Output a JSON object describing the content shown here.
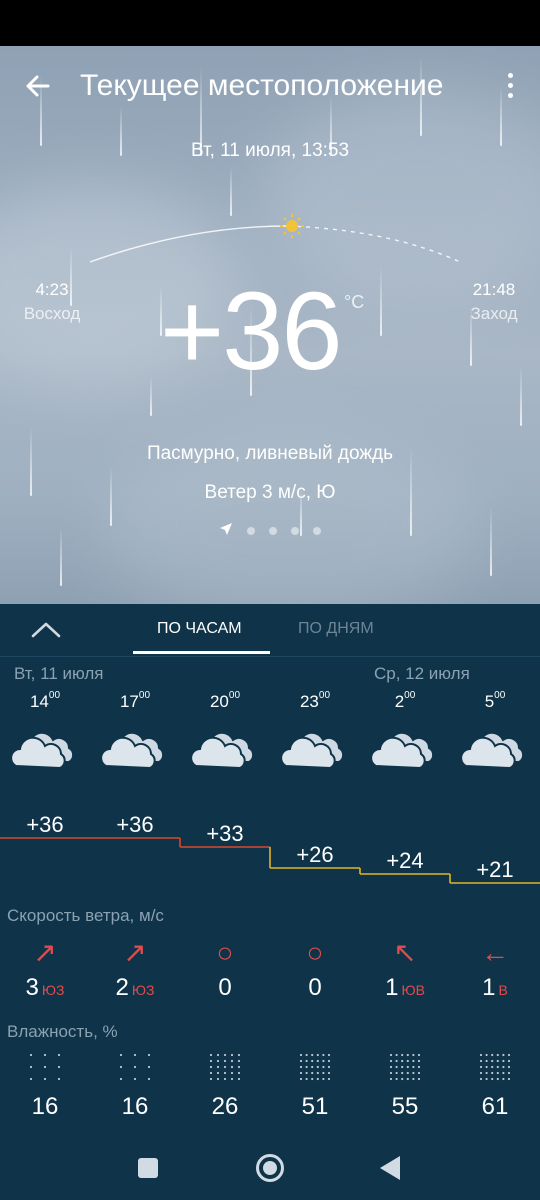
{
  "header": {
    "title": "Текущее местоположение",
    "datetime": "Вт, 11 июля, 13:53"
  },
  "sun": {
    "sunrise_time": "4:23",
    "sunrise_label": "Восход",
    "sunset_time": "21:48",
    "sunset_label": "Заход"
  },
  "current": {
    "temperature": "+36",
    "unit": "°C",
    "condition": "Пасмурно, ливневый дождь",
    "wind": "Ветер 3 м/с, Ю"
  },
  "tabs": {
    "hourly": "ПО ЧАСАМ",
    "daily": "ПО ДНЯМ"
  },
  "days": {
    "day1": "Вт, 11 июля",
    "day2": "Ср, 12 июля"
  },
  "hours": [
    {
      "h": "14",
      "m": "00",
      "temp": "+36",
      "temp_value": 36,
      "wind": "3",
      "wind_dir": "ЮЗ",
      "wind_arrow": "↗",
      "humidity": "16",
      "icon": "cloud-icon"
    },
    {
      "h": "17",
      "m": "00",
      "temp": "+36",
      "temp_value": 36,
      "wind": "2",
      "wind_dir": "ЮЗ",
      "wind_arrow": "↗",
      "humidity": "16",
      "icon": "cloud-icon"
    },
    {
      "h": "20",
      "m": "00",
      "temp": "+33",
      "temp_value": 33,
      "wind": "0",
      "wind_dir": "",
      "wind_arrow": "○",
      "humidity": "26",
      "icon": "cloud-icon"
    },
    {
      "h": "23",
      "m": "00",
      "temp": "+26",
      "temp_value": 26,
      "wind": "0",
      "wind_dir": "",
      "wind_arrow": "○",
      "humidity": "51",
      "icon": "cloud-icon"
    },
    {
      "h": "2",
      "m": "00",
      "temp": "+24",
      "temp_value": 24,
      "wind": "1",
      "wind_dir": "ЮВ",
      "wind_arrow": "↖",
      "humidity": "55",
      "icon": "cloud-icon"
    },
    {
      "h": "5",
      "m": "00",
      "temp": "+21",
      "temp_value": 21,
      "wind": "1",
      "wind_dir": "В",
      "wind_arrow": "←",
      "humidity": "61",
      "icon": "cloud-icon"
    }
  ],
  "sections": {
    "wind_title": "Скорость ветра, м/с",
    "humidity_title": "Влажность, %"
  },
  "colors": {
    "panel": "#0f3348",
    "accent_red": "#e24b4b",
    "temp_line_hot": "#d9492b",
    "temp_line_warm": "#e0b52a"
  },
  "icons": [
    "back-arrow-icon",
    "more-vert-icon",
    "sun-icon",
    "location-arrow-icon",
    "chevron-up-icon",
    "cloud-icon",
    "wind-arrow-icon",
    "humidity-dots-icon",
    "nav-recents-icon",
    "nav-home-icon",
    "nav-back-icon"
  ]
}
